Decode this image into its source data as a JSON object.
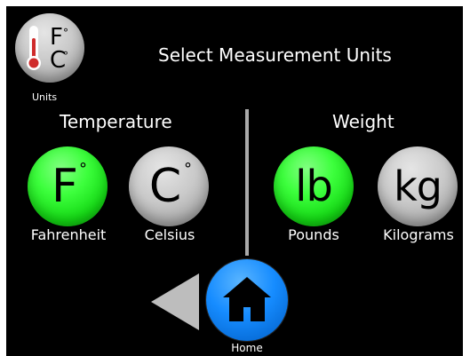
{
  "header": {
    "title": "Select Measurement Units",
    "units_icon": "thermometer-icon",
    "units_label": "Units",
    "units_top_symbol": "F",
    "units_bottom_symbol": "C",
    "degree_symbol": "°"
  },
  "temperature": {
    "heading": "Temperature",
    "options": [
      {
        "symbol": "F",
        "degree": "°",
        "label": "Fahrenheit",
        "state": "selected",
        "color": "#33ff33"
      },
      {
        "symbol": "C",
        "degree": "°",
        "label": "Celsius",
        "state": "unselected",
        "color": "#c9c9c9"
      }
    ]
  },
  "weight": {
    "heading": "Weight",
    "options": [
      {
        "symbol": "lb",
        "label": "Pounds",
        "state": "selected",
        "color": "#33ff33"
      },
      {
        "symbol": "kg",
        "label": "Kilograms",
        "state": "unselected",
        "color": "#c9c9c9"
      }
    ]
  },
  "navigation": {
    "back_icon": "back-arrow-icon",
    "home_icon": "home-icon",
    "home_label": "Home"
  },
  "colors": {
    "background": "#000000",
    "foreground": "#ffffff",
    "selected": "#33ff33",
    "unselected": "#c9c9c9",
    "home": "#168cff",
    "divider": "#a9a9a9"
  }
}
